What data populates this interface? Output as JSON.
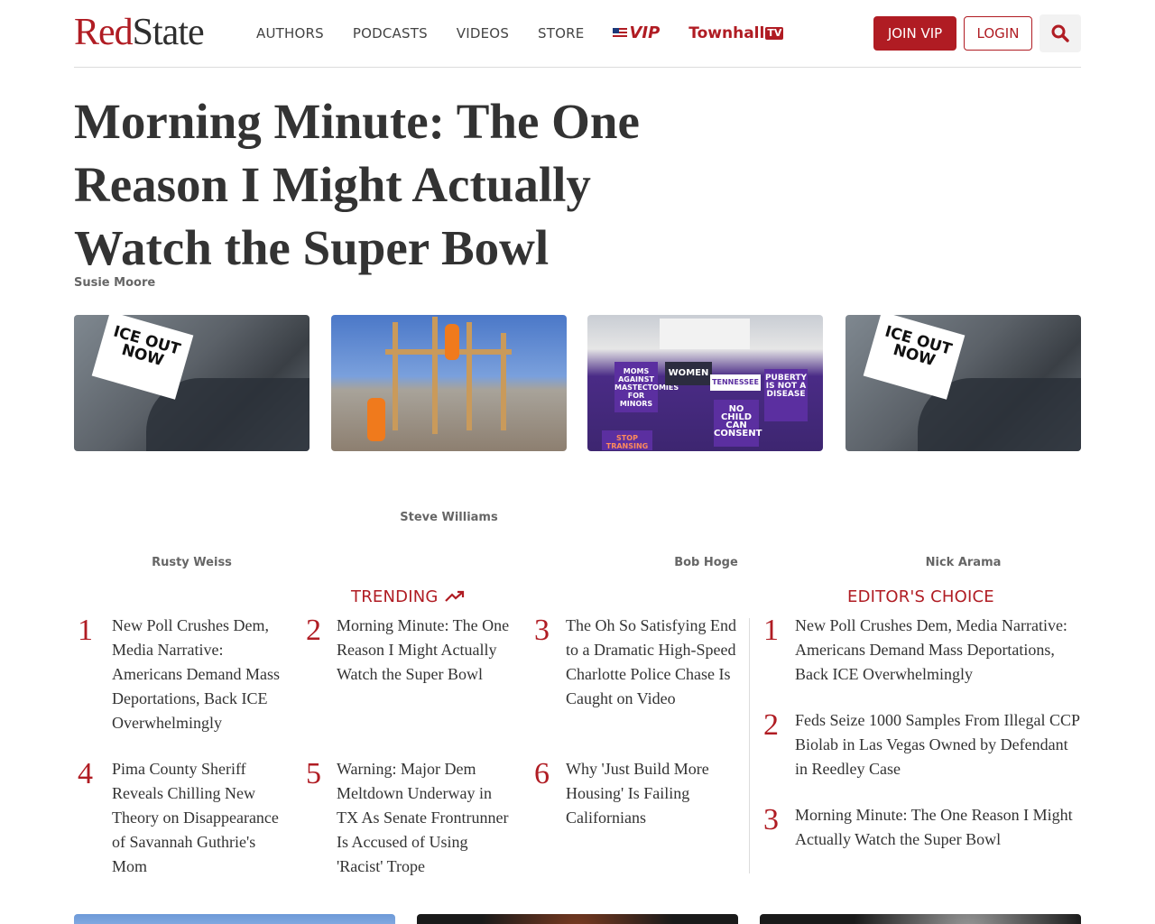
{
  "header": {
    "logo_red": "Red",
    "logo_dark": "State",
    "nav": [
      "AUTHORS",
      "PODCASTS",
      "VIDEOS",
      "STORE"
    ],
    "vip_label": "VIP",
    "townhall_label": "Townhall",
    "townhall_tv": "TV",
    "join_label": "JOIN VIP",
    "login_label": "LOGIN",
    "search_icon": "search-icon"
  },
  "article": {
    "title": "Morning Minute: The One Reason I Might Actually Watch the Super Bowl",
    "author": "Susie Moore"
  },
  "thumbnails": [
    {
      "sign_text": "ICE OUT NOW",
      "author": "Rusty Weiss"
    },
    {
      "author": "Steve Williams"
    },
    {
      "signs": [
        "MOMS AGAINST MASTECTOMIES FOR MINORS",
        "WOMEN",
        "TENNESSEE",
        "PUBERTY IS NOT A DISEASE",
        "NO CHILD CAN CONSENT",
        "STOP TRANSING"
      ],
      "author": "Bob Hoge"
    },
    {
      "sign_text": "ICE OUT NOW",
      "author": "Nick Arama"
    }
  ],
  "trending": {
    "heading": "TRENDING",
    "icon": "trending-up-icon",
    "items": [
      {
        "num": "1",
        "title": "New Poll Crushes Dem, Media Narrative: Americans Demand Mass Deportations, Back ICE Overwhelmingly"
      },
      {
        "num": "2",
        "title": "Morning Minute: The One Reason I Might Actually Watch the Super Bowl"
      },
      {
        "num": "3",
        "title": "The Oh So Satisfying End to a Dramatic High-Speed Charlotte Police Chase Is Caught on Video"
      },
      {
        "num": "4",
        "title": "Pima County Sheriff Reveals Chilling New Theory on Disappearance of Savannah Guthrie's Mom"
      },
      {
        "num": "5",
        "title": "Warning: Major Dem Meltdown Underway in TX As Senate Frontrunner Is Accused of Using 'Racist' Trope"
      },
      {
        "num": "6",
        "title": "Why 'Just Build More Housing' Is Failing Californians"
      }
    ]
  },
  "editors_choice": {
    "heading": "EDITOR'S CHOICE",
    "items": [
      {
        "num": "1",
        "title": "New Poll Crushes Dem, Media Narrative: Americans Demand Mass Deportations, Back ICE Overwhelmingly"
      },
      {
        "num": "2",
        "title": "Feds Seize 1000 Samples From Illegal CCP Biolab in Las Vegas Owned by Defendant in Reedley Case"
      },
      {
        "num": "3",
        "title": "Morning Minute: The One Reason I Might Actually Watch the Super Bowl"
      }
    ]
  },
  "colors": {
    "brand_red": "#b01c23",
    "text": "#333333",
    "muted": "#666666"
  }
}
